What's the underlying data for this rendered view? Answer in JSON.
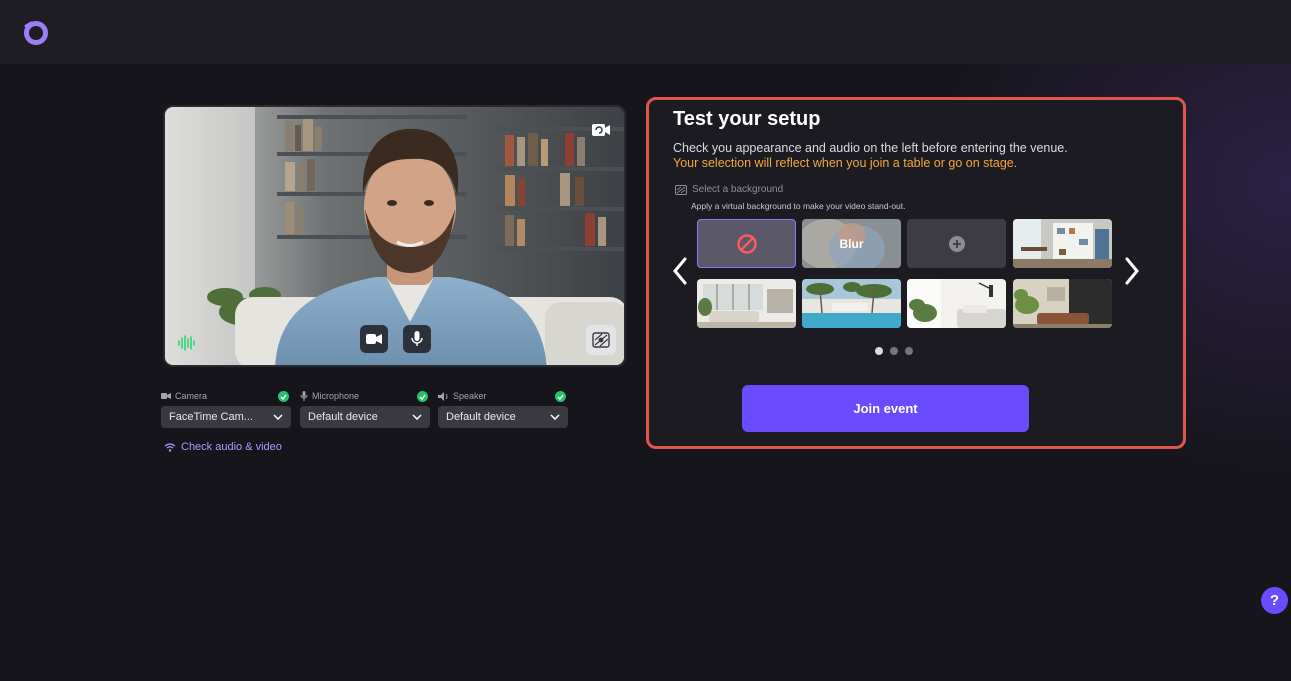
{
  "app": {
    "logo_icon": "app-logo-icon"
  },
  "devices": {
    "camera": {
      "label": "Camera",
      "value": "FaceTime Cam...",
      "icon": "video-camera-icon",
      "status": "ok"
    },
    "microphone": {
      "label": "Microphone",
      "value": "Default device",
      "icon": "microphone-icon",
      "status": "ok"
    },
    "speaker": {
      "label": "Speaker",
      "value": "Default device",
      "icon": "speaker-icon",
      "status": "ok"
    },
    "check_link": "Check audio & video"
  },
  "setup": {
    "title": "Test your setup",
    "description": "Check you appearance and audio on the left before entering the venue.",
    "note": "Your selection will reflect when you join a table or go on stage.",
    "background_heading": "Select a background",
    "background_hint": "Apply a virtual background to make your video stand-out.",
    "tiles": [
      {
        "type": "none",
        "icon": "no-background-icon",
        "selected": true
      },
      {
        "type": "blur",
        "label": "Blur"
      },
      {
        "type": "upload",
        "icon": "add-icon"
      },
      {
        "type": "image",
        "scene": "home-office-bookshelf"
      },
      {
        "type": "image",
        "scene": "bright-living-room"
      },
      {
        "type": "image",
        "scene": "palm-tree-pool"
      },
      {
        "type": "image",
        "scene": "bedroom-plants"
      },
      {
        "type": "image",
        "scene": "lounge-corner"
      }
    ],
    "pagination": {
      "pages": 3,
      "current": 1
    },
    "join_label": "Join event"
  },
  "help_label": "?",
  "colors": {
    "accent": "#6a4bff",
    "highlight_border": "#e2554a",
    "note": "#f2a83b",
    "ok": "#27c26a"
  }
}
